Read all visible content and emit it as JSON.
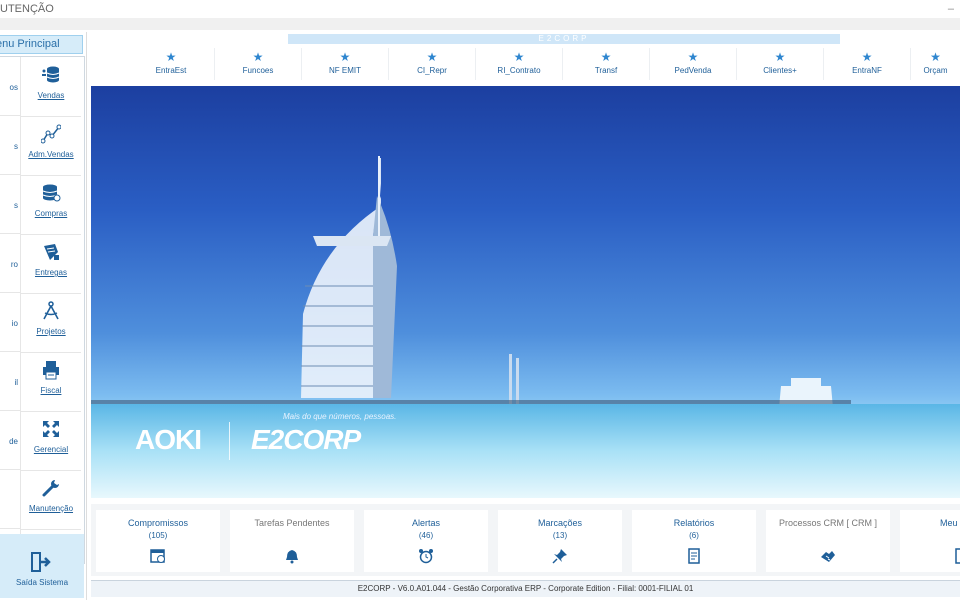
{
  "window": {
    "title": "UTENÇÃO",
    "minimize_glyph": "–"
  },
  "sidebar": {
    "header": "enu Principal",
    "left_fragments": [
      "os",
      "s",
      "s",
      "ro",
      "io",
      "il",
      "de",
      ""
    ],
    "items": [
      {
        "label": "Vendas",
        "icon": "database-icon"
      },
      {
        "label": "Adm.Vendas",
        "icon": "line-chart-icon"
      },
      {
        "label": "Compras",
        "icon": "database-icon"
      },
      {
        "label": "Entregas",
        "icon": "delivery-icon"
      },
      {
        "label": "Projetos",
        "icon": "compass-icon"
      },
      {
        "label": "Fiscal",
        "icon": "printer-icon"
      },
      {
        "label": "Gerencial",
        "icon": "expand-arrows-icon"
      },
      {
        "label": "Manutenção",
        "icon": "wrench-icon"
      }
    ],
    "exit_label": "Saída Sistema"
  },
  "brand_bar": "E2CORP",
  "shortcuts": [
    "EntraEst",
    "Funcoes",
    "NF EMIT",
    "CI_Repr",
    "RI_Contrato",
    "Transf",
    "PedVenda",
    "Clientes+",
    "EntraNF",
    "Orçam"
  ],
  "banner": {
    "tagline": "Mais do que números, pessoas.",
    "logo_left": "AOKI",
    "logo_right": "E2CORP"
  },
  "bottom_tiles": [
    {
      "label": "Compromissos",
      "count": "(105)",
      "icon": "calendar-icon",
      "muted": false
    },
    {
      "label": "Tarefas Pendentes",
      "count": "",
      "icon": "bell-icon",
      "muted": true
    },
    {
      "label": "Alertas",
      "count": "(46)",
      "icon": "alarm-clock-icon",
      "muted": false
    },
    {
      "label": "Marcações",
      "count": "(13)",
      "icon": "pin-icon",
      "muted": false
    },
    {
      "label": "Relatórios",
      "count": "(6)",
      "icon": "report-icon",
      "muted": false
    },
    {
      "label": "Processos CRM [ CRM ]",
      "count": "",
      "icon": "handshake-icon",
      "muted": true
    },
    {
      "label": "Meu",
      "count": "",
      "icon": "document-icon",
      "muted": false
    }
  ],
  "status": "E2CORP - V6.0.A01.044 - Gestão Corporativa ERP - Corporate Edition  -  Filial: 0001-FILIAL 01",
  "colors": {
    "accent": "#1f5f99",
    "star": "#2f86cf",
    "panel": "#d6ecf9"
  }
}
